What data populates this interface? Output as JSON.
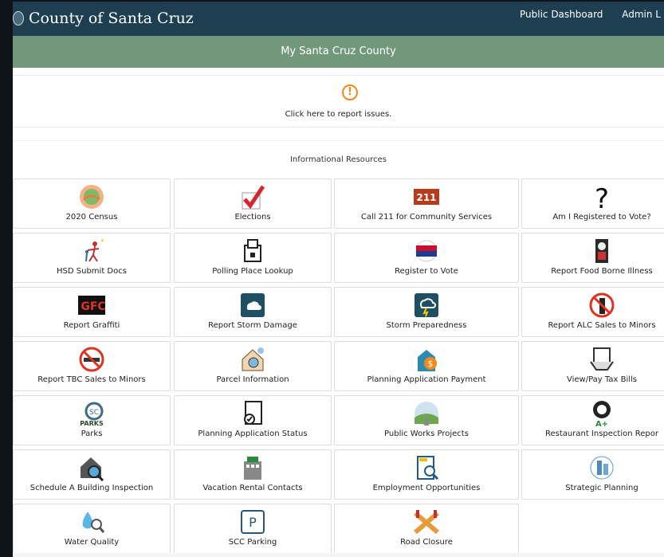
{
  "header": {
    "brand": "County of Santa Cruz",
    "links": [
      "Public Dashboard",
      "Admin L"
    ]
  },
  "subheader": {
    "title": "My Santa Cruz County"
  },
  "report": {
    "label": "Click here to report issues."
  },
  "resources": {
    "title": "Informational Resources",
    "tiles": [
      {
        "label": "2020 Census",
        "icon": "census-icon"
      },
      {
        "label": "Elections",
        "icon": "checkmark-icon"
      },
      {
        "label": "Call 211 for Community Services",
        "icon": "211-icon"
      },
      {
        "label": "Am I Registered to Vote?",
        "icon": "question-icon"
      },
      {
        "label": "HSD Submit Docs",
        "icon": "people-icon"
      },
      {
        "label": "Polling Place Lookup",
        "icon": "ballot-box-icon"
      },
      {
        "label": "Register to Vote",
        "icon": "register-badge-icon"
      },
      {
        "label": "Report Food Borne Illness",
        "icon": "chef-icon"
      },
      {
        "label": "Report Graffiti",
        "icon": "graffiti-icon"
      },
      {
        "label": "Report Storm Damage",
        "icon": "cloud-icon"
      },
      {
        "label": "Storm Preparedness",
        "icon": "storm-icon"
      },
      {
        "label": "Report ALC Sales to Minors",
        "icon": "no-alcohol-icon"
      },
      {
        "label": "Report TBC Sales to Minors",
        "icon": "no-smoking-icon"
      },
      {
        "label": "Parcel Information",
        "icon": "house-search-icon"
      },
      {
        "label": "Planning Application Payment",
        "icon": "payment-icon"
      },
      {
        "label": "View/Pay Tax Bills",
        "icon": "tax-bill-icon"
      },
      {
        "label": "Parks",
        "icon": "parks-logo-icon"
      },
      {
        "label": "Planning Application Status",
        "icon": "document-check-icon"
      },
      {
        "label": "Public Works Projects",
        "icon": "road-landscape-icon"
      },
      {
        "label": "Restaurant Inspection Repor",
        "icon": "restaurant-grade-icon"
      },
      {
        "label": "Schedule A Building Inspection",
        "icon": "house-inspect-icon"
      },
      {
        "label": "Vacation Rental Contacts",
        "icon": "building-icon"
      },
      {
        "label": "Employment Opportunities",
        "icon": "job-search-icon"
      },
      {
        "label": "Strategic Planning",
        "icon": "strategy-icon"
      },
      {
        "label": "Water Quality",
        "icon": "water-drop-icon"
      },
      {
        "label": "SCC Parking",
        "icon": "parking-icon"
      },
      {
        "label": "Road Closure",
        "icon": "road-closure-icon"
      }
    ]
  }
}
